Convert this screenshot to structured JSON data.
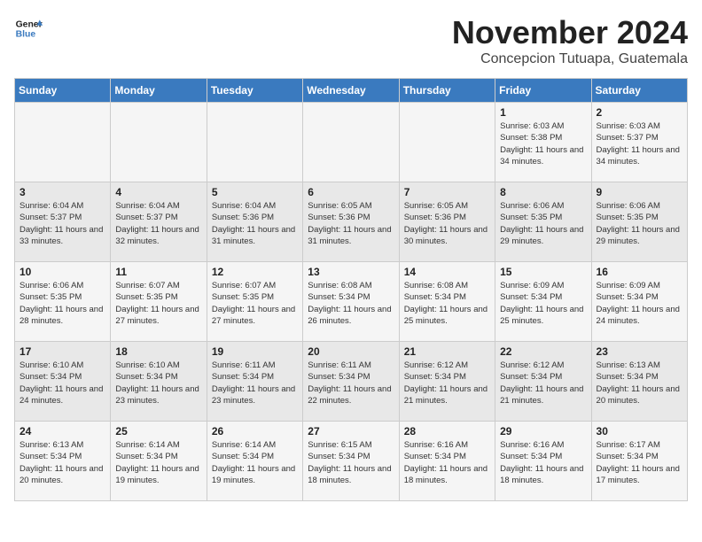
{
  "header": {
    "logo_line1": "General",
    "logo_line2": "Blue",
    "month_title": "November 2024",
    "location": "Concepcion Tutuapa, Guatemala"
  },
  "weekdays": [
    "Sunday",
    "Monday",
    "Tuesday",
    "Wednesday",
    "Thursday",
    "Friday",
    "Saturday"
  ],
  "weeks": [
    [
      {
        "day": "",
        "info": ""
      },
      {
        "day": "",
        "info": ""
      },
      {
        "day": "",
        "info": ""
      },
      {
        "day": "",
        "info": ""
      },
      {
        "day": "",
        "info": ""
      },
      {
        "day": "1",
        "info": "Sunrise: 6:03 AM\nSunset: 5:38 PM\nDaylight: 11 hours and 34 minutes."
      },
      {
        "day": "2",
        "info": "Sunrise: 6:03 AM\nSunset: 5:37 PM\nDaylight: 11 hours and 34 minutes."
      }
    ],
    [
      {
        "day": "3",
        "info": "Sunrise: 6:04 AM\nSunset: 5:37 PM\nDaylight: 11 hours and 33 minutes."
      },
      {
        "day": "4",
        "info": "Sunrise: 6:04 AM\nSunset: 5:37 PM\nDaylight: 11 hours and 32 minutes."
      },
      {
        "day": "5",
        "info": "Sunrise: 6:04 AM\nSunset: 5:36 PM\nDaylight: 11 hours and 31 minutes."
      },
      {
        "day": "6",
        "info": "Sunrise: 6:05 AM\nSunset: 5:36 PM\nDaylight: 11 hours and 31 minutes."
      },
      {
        "day": "7",
        "info": "Sunrise: 6:05 AM\nSunset: 5:36 PM\nDaylight: 11 hours and 30 minutes."
      },
      {
        "day": "8",
        "info": "Sunrise: 6:06 AM\nSunset: 5:35 PM\nDaylight: 11 hours and 29 minutes."
      },
      {
        "day": "9",
        "info": "Sunrise: 6:06 AM\nSunset: 5:35 PM\nDaylight: 11 hours and 29 minutes."
      }
    ],
    [
      {
        "day": "10",
        "info": "Sunrise: 6:06 AM\nSunset: 5:35 PM\nDaylight: 11 hours and 28 minutes."
      },
      {
        "day": "11",
        "info": "Sunrise: 6:07 AM\nSunset: 5:35 PM\nDaylight: 11 hours and 27 minutes."
      },
      {
        "day": "12",
        "info": "Sunrise: 6:07 AM\nSunset: 5:35 PM\nDaylight: 11 hours and 27 minutes."
      },
      {
        "day": "13",
        "info": "Sunrise: 6:08 AM\nSunset: 5:34 PM\nDaylight: 11 hours and 26 minutes."
      },
      {
        "day": "14",
        "info": "Sunrise: 6:08 AM\nSunset: 5:34 PM\nDaylight: 11 hours and 25 minutes."
      },
      {
        "day": "15",
        "info": "Sunrise: 6:09 AM\nSunset: 5:34 PM\nDaylight: 11 hours and 25 minutes."
      },
      {
        "day": "16",
        "info": "Sunrise: 6:09 AM\nSunset: 5:34 PM\nDaylight: 11 hours and 24 minutes."
      }
    ],
    [
      {
        "day": "17",
        "info": "Sunrise: 6:10 AM\nSunset: 5:34 PM\nDaylight: 11 hours and 24 minutes."
      },
      {
        "day": "18",
        "info": "Sunrise: 6:10 AM\nSunset: 5:34 PM\nDaylight: 11 hours and 23 minutes."
      },
      {
        "day": "19",
        "info": "Sunrise: 6:11 AM\nSunset: 5:34 PM\nDaylight: 11 hours and 23 minutes."
      },
      {
        "day": "20",
        "info": "Sunrise: 6:11 AM\nSunset: 5:34 PM\nDaylight: 11 hours and 22 minutes."
      },
      {
        "day": "21",
        "info": "Sunrise: 6:12 AM\nSunset: 5:34 PM\nDaylight: 11 hours and 21 minutes."
      },
      {
        "day": "22",
        "info": "Sunrise: 6:12 AM\nSunset: 5:34 PM\nDaylight: 11 hours and 21 minutes."
      },
      {
        "day": "23",
        "info": "Sunrise: 6:13 AM\nSunset: 5:34 PM\nDaylight: 11 hours and 20 minutes."
      }
    ],
    [
      {
        "day": "24",
        "info": "Sunrise: 6:13 AM\nSunset: 5:34 PM\nDaylight: 11 hours and 20 minutes."
      },
      {
        "day": "25",
        "info": "Sunrise: 6:14 AM\nSunset: 5:34 PM\nDaylight: 11 hours and 19 minutes."
      },
      {
        "day": "26",
        "info": "Sunrise: 6:14 AM\nSunset: 5:34 PM\nDaylight: 11 hours and 19 minutes."
      },
      {
        "day": "27",
        "info": "Sunrise: 6:15 AM\nSunset: 5:34 PM\nDaylight: 11 hours and 18 minutes."
      },
      {
        "day": "28",
        "info": "Sunrise: 6:16 AM\nSunset: 5:34 PM\nDaylight: 11 hours and 18 minutes."
      },
      {
        "day": "29",
        "info": "Sunrise: 6:16 AM\nSunset: 5:34 PM\nDaylight: 11 hours and 18 minutes."
      },
      {
        "day": "30",
        "info": "Sunrise: 6:17 AM\nSunset: 5:34 PM\nDaylight: 11 hours and 17 minutes."
      }
    ]
  ]
}
